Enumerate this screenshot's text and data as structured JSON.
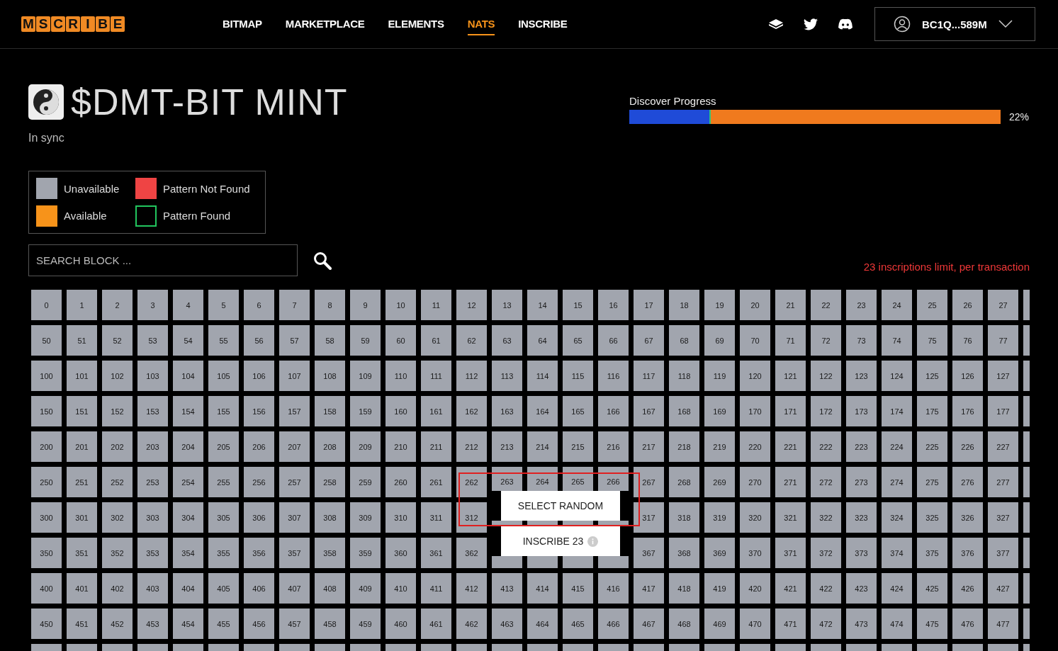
{
  "header": {
    "logo": [
      "M",
      "S",
      "C",
      "R",
      "I",
      "B",
      "E"
    ],
    "nav": [
      {
        "label": "BITMAP",
        "selected": false
      },
      {
        "label": "MARKETPLACE",
        "selected": false
      },
      {
        "label": "ELEMENTS",
        "selected": false
      },
      {
        "label": "NATS",
        "selected": true
      },
      {
        "label": "INSCRIBE",
        "selected": false
      }
    ],
    "wallet": {
      "address": "BC1Q...589M"
    }
  },
  "title": "$DMT-BIT MINT",
  "sync_status": "In sync",
  "progress": {
    "label": "Discover Progress",
    "level": 0.22,
    "reading": "22%"
  },
  "legend": [
    {
      "label": "Unavailable",
      "kind": "unavailable"
    },
    {
      "label": "Pattern Not Found",
      "kind": "not_found"
    },
    {
      "label": "Available",
      "kind": "available"
    },
    {
      "label": "Pattern Found",
      "kind": "found"
    }
  ],
  "search": {
    "placeholder": "SEARCH BLOCK ..."
  },
  "limit_note": "23 inscriptions limit, per transaction",
  "grid": [
    {
      "cells": [
        "0",
        "1",
        "2",
        "3",
        "4",
        "5",
        "6",
        "7",
        "8",
        "9",
        "10",
        "11",
        "12",
        "13",
        "14",
        "15",
        "16",
        "17",
        "18",
        "19",
        "20",
        "21",
        "22",
        "23",
        "24",
        "25",
        "26",
        "27"
      ]
    },
    {
      "cells": [
        "50",
        "51",
        "52",
        "53",
        "54",
        "55",
        "56",
        "57",
        "58",
        "59",
        "60",
        "61",
        "62",
        "63",
        "64",
        "65",
        "66",
        "67",
        "68",
        "69",
        "70",
        "71",
        "72",
        "73",
        "74",
        "75",
        "76",
        "77"
      ]
    },
    {
      "cells": [
        "100",
        "101",
        "102",
        "103",
        "104",
        "105",
        "106",
        "107",
        "108",
        "109",
        "110",
        "111",
        "112",
        "113",
        "114",
        "115",
        "116",
        "117",
        "118",
        "119",
        "120",
        "121",
        "122",
        "123",
        "124",
        "125",
        "126",
        "127"
      ]
    },
    {
      "cells": [
        "150",
        "151",
        "152",
        "153",
        "154",
        "155",
        "156",
        "157",
        "158",
        "159",
        "160",
        "161",
        "162",
        "163",
        "164",
        "165",
        "166",
        "167",
        "168",
        "169",
        "170",
        "171",
        "172",
        "173",
        "174",
        "175",
        "176",
        "177"
      ]
    },
    {
      "cells": [
        "200",
        "201",
        "202",
        "203",
        "204",
        "205",
        "206",
        "207",
        "208",
        "209",
        "210",
        "211",
        "212",
        "213",
        "214",
        "215",
        "216",
        "217",
        "218",
        "219",
        "220",
        "221",
        "222",
        "223",
        "224",
        "225",
        "226",
        "227"
      ]
    },
    {
      "cells": [
        "250",
        "251",
        "252",
        "253",
        "254",
        "255",
        "256",
        "257",
        "258",
        "259",
        "260",
        "261",
        "262",
        "263",
        "264",
        "265",
        "266",
        "267",
        "268",
        "269",
        "270",
        "271",
        "272",
        "273",
        "274",
        "275",
        "276",
        "277"
      ]
    },
    {
      "cells": [
        "300",
        "301",
        "302",
        "303",
        "304",
        "305",
        "306",
        "307",
        "308",
        "309",
        "310",
        "311",
        "312"
      ],
      "cells_after_menu": [
        "317",
        "318",
        "319",
        "320",
        "321",
        "322",
        "323",
        "324",
        "325",
        "326",
        "327"
      ]
    },
    {
      "cells": [
        "350",
        "351",
        "352",
        "353",
        "354",
        "355",
        "356",
        "357",
        "358",
        "359",
        "360",
        "361",
        "362"
      ],
      "cells_after_menu": [
        "367",
        "368",
        "369",
        "370",
        "371",
        "372",
        "373",
        "374",
        "375",
        "376",
        "377"
      ]
    },
    {
      "cells": [
        "400",
        "401",
        "402",
        "403",
        "404",
        "405",
        "406",
        "407",
        "408",
        "409",
        "410",
        "411",
        "412",
        "413",
        "414",
        "415",
        "416",
        "417",
        "418",
        "419",
        "420",
        "421",
        "422",
        "423",
        "424",
        "425",
        "426",
        "427"
      ]
    },
    {
      "cells": [
        "450",
        "451",
        "452",
        "453",
        "454",
        "455",
        "456",
        "457",
        "458",
        "459",
        "460",
        "461",
        "462",
        "463",
        "464",
        "465",
        "466",
        "467",
        "468",
        "469",
        "470",
        "471",
        "472",
        "473",
        "474",
        "475",
        "476",
        "477"
      ]
    }
  ],
  "actions": [
    {
      "label": "SELECT RANDOM",
      "kind": "plain"
    },
    {
      "label": "INSCRIBE 23",
      "kind": "info"
    }
  ]
}
